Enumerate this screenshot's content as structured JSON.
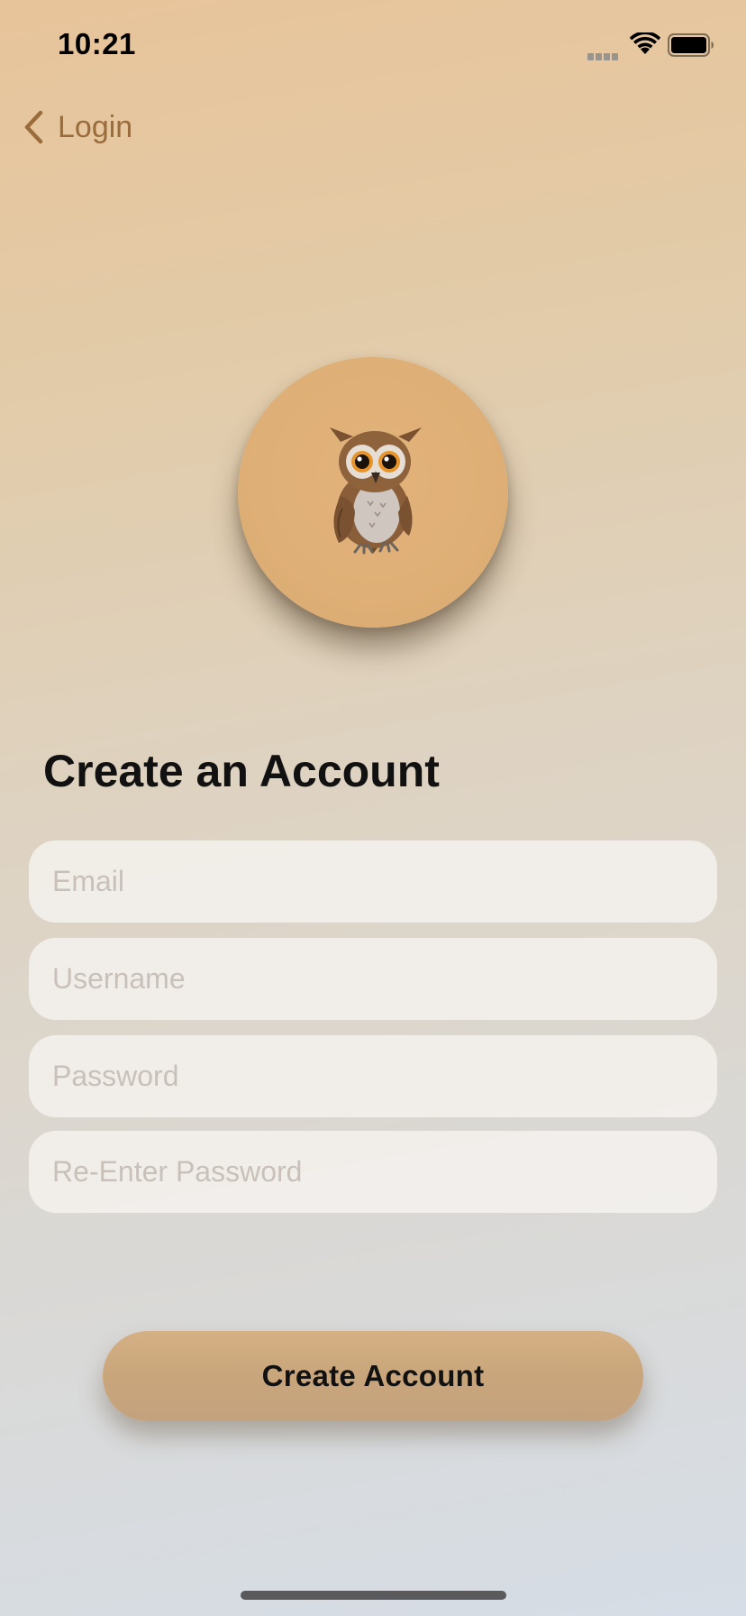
{
  "status_bar": {
    "time": "10:21"
  },
  "nav": {
    "back_label": "Login"
  },
  "avatar": {
    "icon": "owl-icon",
    "circle_color": "#deaf76"
  },
  "form": {
    "title": "Create an Account",
    "email_placeholder": "Email",
    "username_placeholder": "Username",
    "password_placeholder": "Password",
    "reenter_password_placeholder": "Re-Enter Password"
  },
  "actions": {
    "create_account_label": "Create Account"
  },
  "colors": {
    "accent": "#9a6c3c",
    "button": "#c9a57b"
  }
}
